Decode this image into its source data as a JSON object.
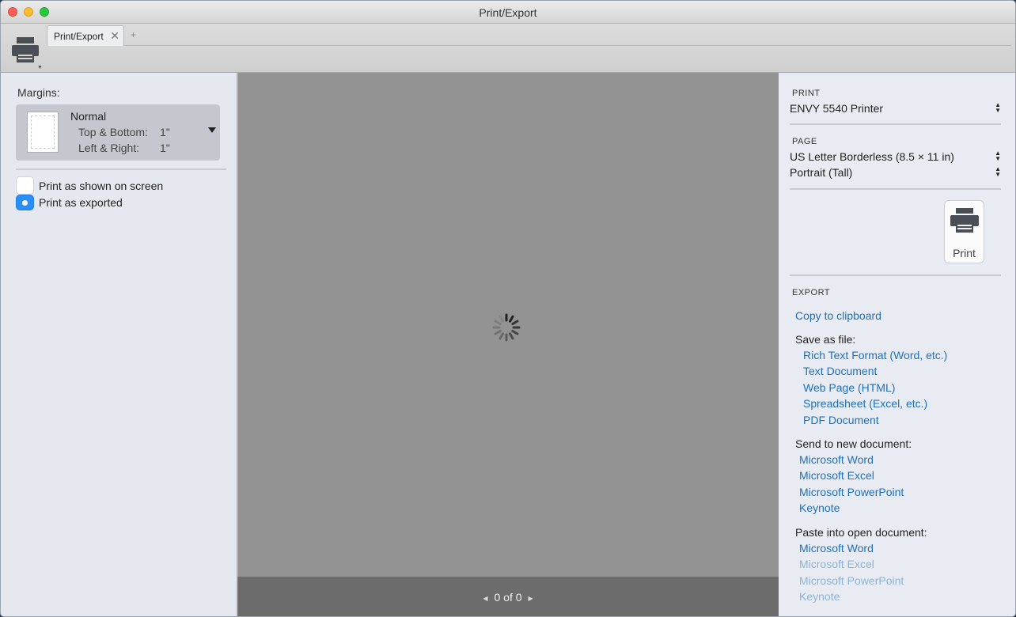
{
  "window": {
    "title": "Print/Export"
  },
  "toolbar": {
    "tab_label": "Print/Export",
    "tab_close": "✕",
    "tab_add": "+"
  },
  "left": {
    "margins_label": "Margins:",
    "margin_preset": {
      "name": "Normal",
      "top_bottom_label": "Top & Bottom:",
      "top_bottom_value": "1\"",
      "left_right_label": "Left & Right:",
      "left_right_value": "1\""
    },
    "options": [
      {
        "label": "Print as shown on screen",
        "selected": false
      },
      {
        "label": "Print as exported",
        "selected": true
      }
    ]
  },
  "preview": {
    "page_indicator": "0 of 0",
    "loading": true
  },
  "right": {
    "print_heading": "PRINT",
    "printer": "ENVY 5540 Printer",
    "page_heading": "PAGE",
    "paper_size": "US Letter Borderless (8.5 × 11 in)",
    "orientation": "Portrait (Tall)",
    "print_button_label": "Print",
    "export_heading": "EXPORT",
    "copy_to_clipboard": "Copy to clipboard",
    "save_as_file_heading": "Save as file:",
    "save_as_file": [
      "Rich Text Format (Word, etc.)",
      "Text Document",
      "Web Page (HTML)",
      "Spreadsheet (Excel, etc.)",
      "PDF Document"
    ],
    "send_to_new_heading": "Send to new document:",
    "send_to_new": [
      "Microsoft Word",
      "Microsoft Excel",
      "Microsoft PowerPoint",
      "Keynote"
    ],
    "paste_into_open_heading": "Paste into open document:",
    "paste_into_open": [
      {
        "label": "Microsoft Word",
        "enabled": true
      },
      {
        "label": "Microsoft Excel",
        "enabled": false
      },
      {
        "label": "Microsoft PowerPoint",
        "enabled": false
      },
      {
        "label": "Keynote",
        "enabled": false
      }
    ]
  },
  "colors": {
    "link": "#1f6fbd",
    "link_disabled": "#8fb3d6",
    "radio_selected": "#2d8ef6",
    "preview_bg": "#939393",
    "pager_bg": "#6c6c6c"
  }
}
